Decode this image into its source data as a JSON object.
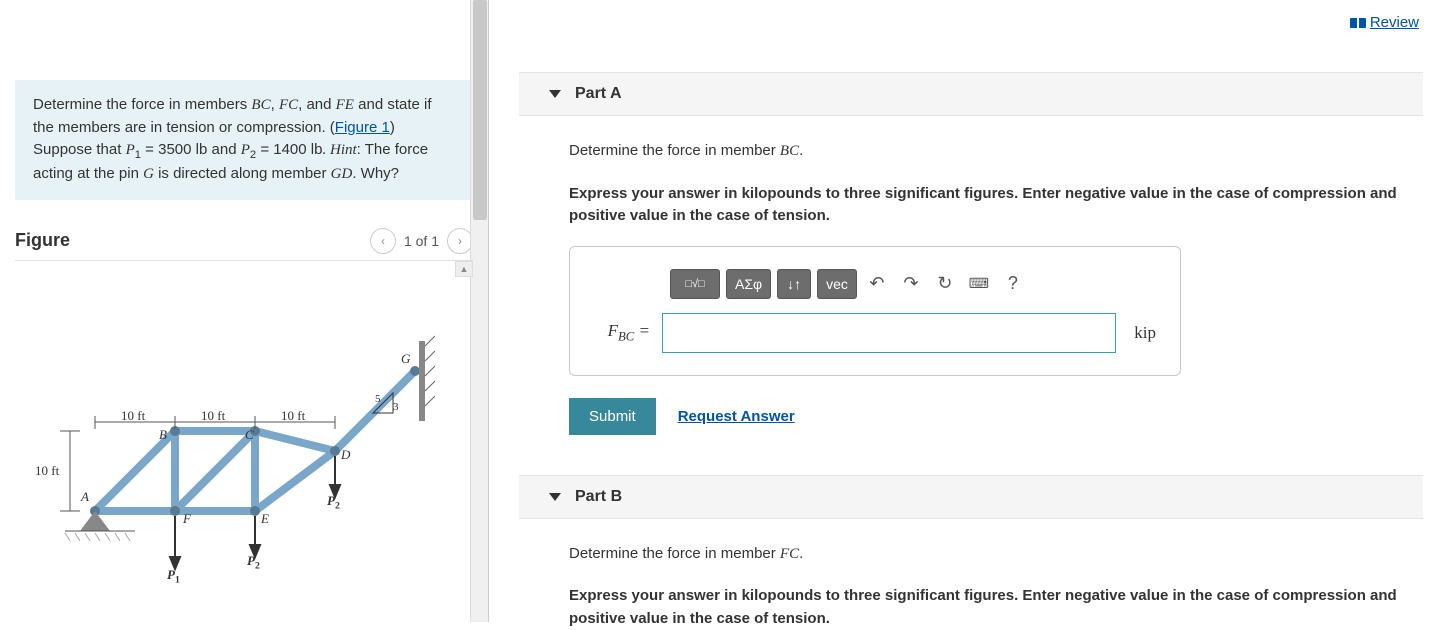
{
  "review_label": "Review",
  "problem": {
    "line1a": "Determine the force in members ",
    "m1": "BC",
    "sep1": ", ",
    "m2": "FC",
    "sep2": ", and ",
    "m3": "FE",
    "line2": " and state if the members are in tension or compression. (",
    "figure_link": "Figure 1",
    "line3a": ") Suppose that ",
    "p1sym": "P",
    "p1sub": "1",
    "eq1": " = 3500 ",
    "unit1": "lb",
    "line4a": " and ",
    "p2sym": "P",
    "p2sub": "2",
    "eq2": " = 1400 ",
    "unit2": "lb",
    "hint_label": ". Hint",
    "hint_text": ": The force acting at the pin ",
    "g": "G",
    "hint_text2": " is directed along member ",
    "gd": "GD",
    "why": ". Why?"
  },
  "figure": {
    "title": "Figure",
    "pager": "1 of 1",
    "labels": {
      "d10a": "10 ft",
      "d10b": "10 ft",
      "d10c": "10 ft",
      "h10": "10 ft",
      "s5": "5",
      "s3": "3",
      "A": "A",
      "B": "B",
      "C": "C",
      "D": "D",
      "E": "E",
      "F": "F",
      "G": "G",
      "P1": "P",
      "P1s": "1",
      "P2a": "P",
      "P2as": "2",
      "P2b": "P",
      "P2bs": "2"
    }
  },
  "partA": {
    "title": "Part A",
    "prompt_a": "Determine the force in member ",
    "prompt_mem": "BC",
    "prompt_end": ".",
    "instruction": "Express your answer in kilopounds to three significant figures. Enter negative value in the case of compression and positive value in the case of tension.",
    "toolbar": {
      "templates": "▪",
      "sqrt": "√",
      "greek": "ΑΣφ",
      "subsup": "↓↑",
      "vec": "vec",
      "undo": "↶",
      "redo": "↷",
      "reset": "↻",
      "keyboard": "⌨",
      "help": "?"
    },
    "var": "F",
    "varsub": "BC",
    "equals": " = ",
    "unit": "kip",
    "submit": "Submit",
    "request": "Request Answer"
  },
  "partB": {
    "title": "Part B",
    "prompt_a": "Determine the force in member ",
    "prompt_mem": "FC",
    "prompt_end": ".",
    "instruction": "Express your answer in kilopounds to three significant figures. Enter negative value in the case of compression and positive value in the case of tension."
  }
}
